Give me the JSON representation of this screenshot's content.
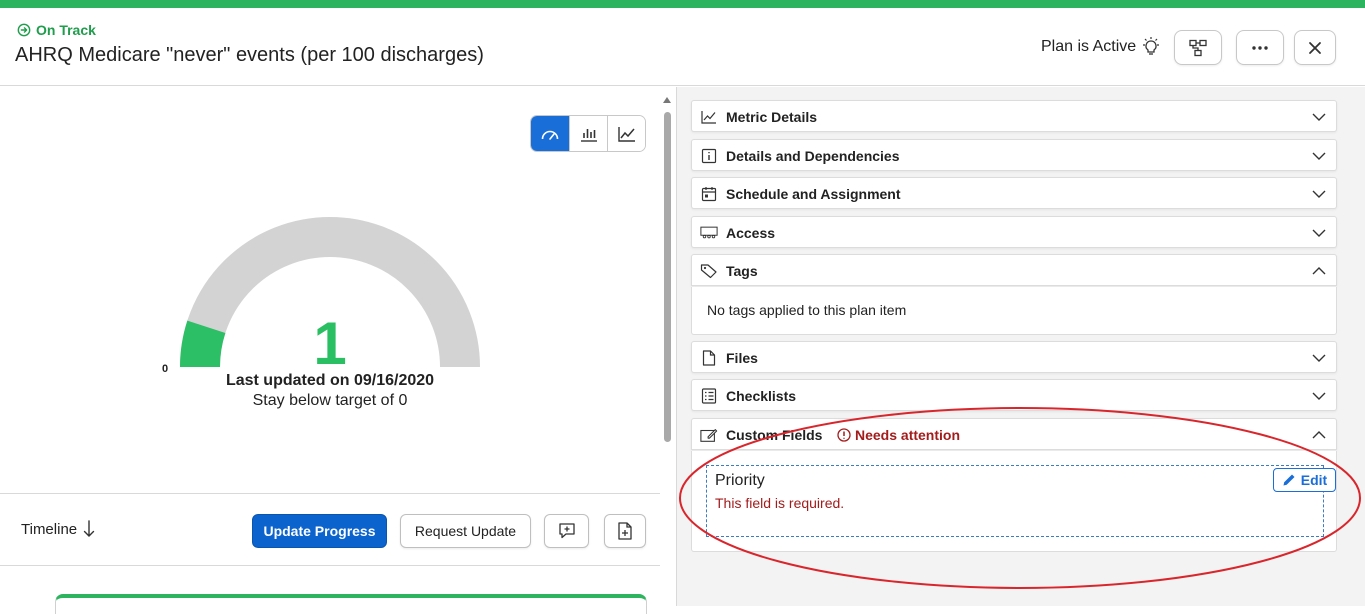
{
  "header": {
    "status": "On Track",
    "title": "AHRQ Medicare \"never\" events (per 100 discharges)",
    "plan_status": "Plan is Active"
  },
  "gauge": {
    "value": "1",
    "min_label": "0",
    "fill_fraction": 0.1,
    "last_updated": "Last updated on 09/16/2020",
    "target_text": "Stay below target of 0",
    "fill_color": "#2dbf65",
    "track_color": "#d3d3d3"
  },
  "timeline": {
    "label": "Timeline",
    "update_progress": "Update Progress",
    "request_update": "Request Update"
  },
  "sections": {
    "metric_details": "Metric Details",
    "details_dependencies": "Details and Dependencies",
    "schedule_assignment": "Schedule and Assignment",
    "access": "Access",
    "tags": "Tags",
    "tags_empty": "No tags applied to this plan item",
    "files": "Files",
    "checklists": "Checklists",
    "custom_fields": "Custom Fields",
    "needs_attention": "Needs attention"
  },
  "custom_field": {
    "label": "Priority",
    "error": "This field is required.",
    "edit_label": "Edit"
  },
  "colors": {
    "accent": "#0b63ce",
    "success": "#2db45e",
    "error": "#a31c1c"
  }
}
